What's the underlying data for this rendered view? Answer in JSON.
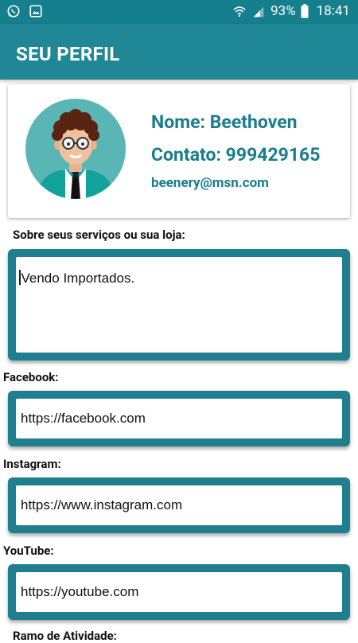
{
  "status_bar": {
    "battery": "93%",
    "time": "18:41",
    "icons": [
      "whatsapp-icon",
      "gallery-icon",
      "wifi-icon",
      "signal-icon",
      "battery-icon"
    ]
  },
  "header": {
    "title": "SEU PERFIL"
  },
  "profile": {
    "name": "Nome: Beethoven",
    "contact": "Contato: 999429165",
    "email": "beenery@msn.com"
  },
  "about": {
    "label": "Sobre seus serviços ou sua loja:",
    "value": "Vendo Importados."
  },
  "facebook": {
    "label": "Facebook:",
    "value": "https://facebook.com"
  },
  "instagram": {
    "label": "Instagram:",
    "value": "https://www.instagram.com"
  },
  "youtube": {
    "label": "YouTube:",
    "value": "https://youtube.com"
  },
  "ramo": {
    "label": "Ramo de Atividade:"
  },
  "colors": {
    "primary": "#1f8796",
    "status_bar": "#167f8e",
    "accent_text": "#1a7d8c",
    "field_frame": "#1f7f8e"
  }
}
